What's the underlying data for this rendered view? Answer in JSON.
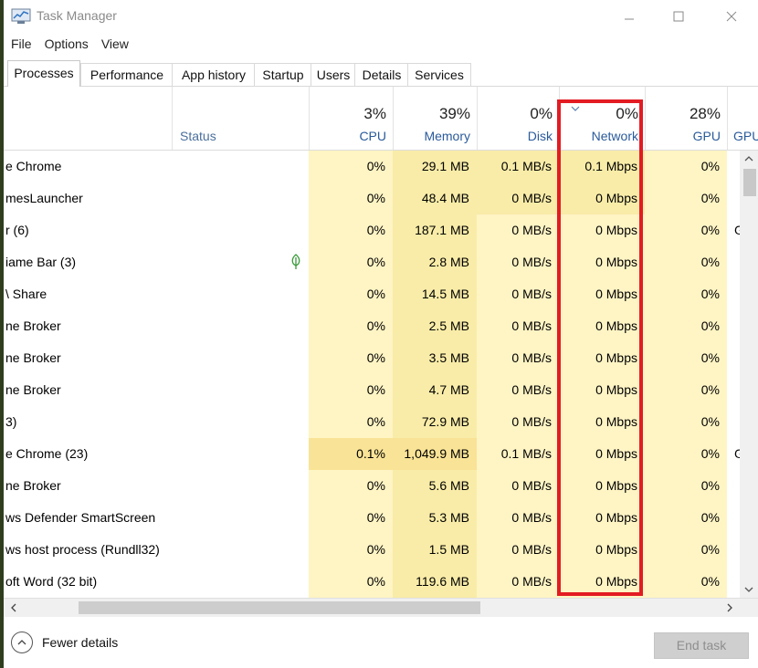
{
  "window": {
    "title": "Task Manager"
  },
  "menu": [
    "File",
    "Options",
    "View"
  ],
  "tabs": [
    "Processes",
    "Performance",
    "App history",
    "Startup",
    "Users",
    "Details",
    "Services"
  ],
  "active_tab": "Processes",
  "columns": {
    "status": {
      "label": "Status"
    },
    "cpu": {
      "label": "CPU",
      "pct": "3%"
    },
    "memory": {
      "label": "Memory",
      "pct": "39%"
    },
    "disk": {
      "label": "Disk",
      "pct": "0%"
    },
    "network": {
      "label": "Network",
      "pct": "0%",
      "sorted": true
    },
    "gpu": {
      "label": "GPU",
      "pct": "28%"
    },
    "gpu2": {
      "label": "GPU"
    }
  },
  "rows": [
    {
      "name": "e Chrome",
      "cpu": "0%",
      "memory": "29.1 MB",
      "disk": "0.1 MB/s",
      "network": "0.1 Mbps",
      "gpu": "0%",
      "gpu2": ""
    },
    {
      "name": "mesLauncher",
      "cpu": "0%",
      "memory": "48.4 MB",
      "disk": "0 MB/s",
      "network": "0 Mbps",
      "gpu": "0%",
      "gpu2": ""
    },
    {
      "name": "r (6)",
      "cpu": "0%",
      "memory": "187.1 MB",
      "disk": "0 MB/s",
      "network": "0 Mbps",
      "gpu": "0%",
      "gpu2": "G"
    },
    {
      "name": "iame Bar (3)",
      "cpu": "0%",
      "memory": "2.8 MB",
      "disk": "0 MB/s",
      "network": "0 Mbps",
      "gpu": "0%",
      "gpu2": "",
      "leaf": true
    },
    {
      "name": "\\ Share",
      "cpu": "0%",
      "memory": "14.5 MB",
      "disk": "0 MB/s",
      "network": "0 Mbps",
      "gpu": "0%",
      "gpu2": ""
    },
    {
      "name": "ne Broker",
      "cpu": "0%",
      "memory": "2.5 MB",
      "disk": "0 MB/s",
      "network": "0 Mbps",
      "gpu": "0%",
      "gpu2": ""
    },
    {
      "name": "ne Broker",
      "cpu": "0%",
      "memory": "3.5 MB",
      "disk": "0 MB/s",
      "network": "0 Mbps",
      "gpu": "0%",
      "gpu2": ""
    },
    {
      "name": "ne Broker",
      "cpu": "0%",
      "memory": "4.7 MB",
      "disk": "0 MB/s",
      "network": "0 Mbps",
      "gpu": "0%",
      "gpu2": ""
    },
    {
      "name": "3)",
      "cpu": "0%",
      "memory": "72.9 MB",
      "disk": "0 MB/s",
      "network": "0 Mbps",
      "gpu": "0%",
      "gpu2": ""
    },
    {
      "name": "e Chrome (23)",
      "cpu": "0.1%",
      "memory": "1,049.9 MB",
      "disk": "0.1 MB/s",
      "network": "0 Mbps",
      "gpu": "0%",
      "gpu2": "G",
      "hot": true
    },
    {
      "name": "ne Broker",
      "cpu": "0%",
      "memory": "5.6 MB",
      "disk": "0 MB/s",
      "network": "0 Mbps",
      "gpu": "0%",
      "gpu2": ""
    },
    {
      "name": "ws Defender SmartScreen",
      "cpu": "0%",
      "memory": "5.3 MB",
      "disk": "0 MB/s",
      "network": "0 Mbps",
      "gpu": "0%",
      "gpu2": ""
    },
    {
      "name": "ws host process (Rundll32)",
      "cpu": "0%",
      "memory": "1.5 MB",
      "disk": "0 MB/s",
      "network": "0 Mbps",
      "gpu": "0%",
      "gpu2": ""
    },
    {
      "name": "oft Word (32 bit)",
      "cpu": "0%",
      "memory": "119.6 MB",
      "disk": "0 MB/s",
      "network": "0 Mbps",
      "gpu": "0%",
      "gpu2": ""
    }
  ],
  "footer": {
    "fewer_details": "Fewer details",
    "end_task": "End task"
  },
  "colors": {
    "heat_light": "#fff4c4",
    "heat_mid": "#f9eca8",
    "heat_hot": "#f9e396",
    "highlight": "#e31b23"
  },
  "icons": {
    "app": "task-manager-icon",
    "minimize": "minimize-icon",
    "maximize": "maximize-icon",
    "close": "close-icon",
    "sort": "chevron-down-icon",
    "leaf": "efficiency-leaf-icon",
    "fewer": "chevron-up-icon"
  }
}
